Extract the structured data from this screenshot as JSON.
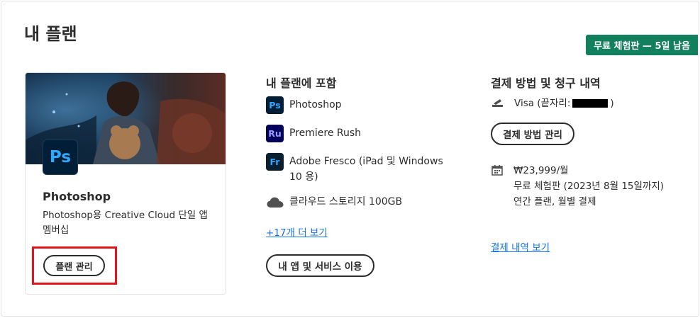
{
  "page": {
    "title": "내 플랜"
  },
  "trial_badge": "무료 체험판 — 5일 남음",
  "plan_card": {
    "icon_text": "Ps",
    "name": "Photoshop",
    "description": "Photoshop용 Creative Cloud 단일 앱 멤버십",
    "manage_button": "플랜 관리"
  },
  "included": {
    "title": "내 플랜에 포함",
    "apps": [
      {
        "icon": "Ps",
        "label": "Photoshop"
      },
      {
        "icon": "Ru",
        "label": "Premiere Rush"
      },
      {
        "icon": "Fr",
        "label": "Adobe Fresco (iPad 및 Windows 10 용)"
      }
    ],
    "storage": {
      "icon": "cloud-icon",
      "label": "클라우드 스토리지 100GB"
    },
    "more_link": "+17개 더 보기",
    "apps_button": "내 앱 및 서비스 이용"
  },
  "billing": {
    "title": "결제 방법 및 청구 내역",
    "card_prefix": "Visa (끝자리:",
    "card_suffix": ")",
    "manage_payment_button": "결제 방법 관리",
    "price": "₩23,999/월",
    "trial_text": "무료 체험판 (2023년 8월 15일까지)",
    "plan_type": "연간 플랜, 월별 결제",
    "history_link": "결제 내역 보기"
  },
  "colors": {
    "accent_link": "#1473e6",
    "badge_green": "#12805c",
    "highlight_red": "#e2141e",
    "ps_blue": "#31a8ff"
  }
}
